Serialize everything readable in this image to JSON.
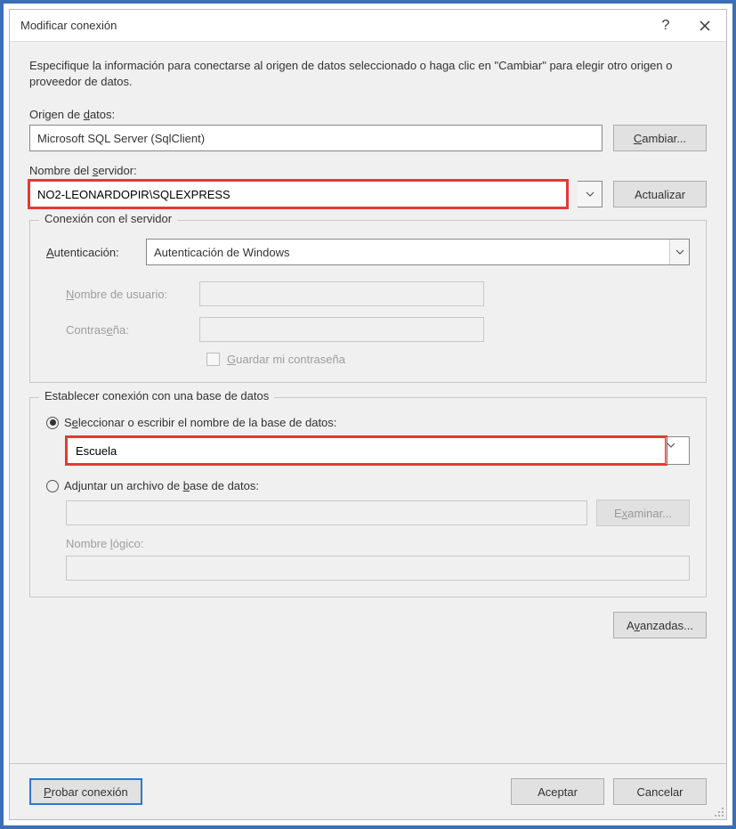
{
  "title": "Modificar conexión",
  "instructions": "Especifique la información para conectarse al origen de datos seleccionado o haga clic en \"Cambiar\" para elegir otro origen o proveedor de datos.",
  "data_source": {
    "label_pre": "Origen de ",
    "label_hot": "d",
    "label_post": "atos:",
    "value": "Microsoft SQL Server (SqlClient)",
    "change_pre": "",
    "change_hot": "C",
    "change_post": "ambiar..."
  },
  "server": {
    "label_pre": "Nombre del ",
    "label_hot": "s",
    "label_post": "ervidor:",
    "value": "NO2-LEONARDOPIR\\SQLEXPRESS",
    "refresh_label": "Actualizar"
  },
  "connection_group": {
    "legend": "Conexión con el servidor",
    "auth_label_hot": "A",
    "auth_label_post": "utenticación:",
    "auth_value": "Autenticación de Windows",
    "user_label_hot": "N",
    "user_label_post": "ombre de usuario:",
    "pass_label_pre": "Contras",
    "pass_label_hot": "e",
    "pass_label_post": "ña:",
    "save_pass_hot": "G",
    "save_pass_post": "uardar mi contraseña"
  },
  "database_group": {
    "legend": "Establecer conexión con una base de datos",
    "radio1_pre": "S",
    "radio1_hot": "e",
    "radio1_post": "leccionar o escribir el nombre de la base de datos:",
    "db_value": "Escuela",
    "radio2_pre": "Adjuntar un archivo de ",
    "radio2_hot": "b",
    "radio2_post": "ase de datos:",
    "browse_pre": "E",
    "browse_hot": "x",
    "browse_post": "aminar...",
    "logical_pre": "Nombre ",
    "logical_hot": "l",
    "logical_post": "ógico:"
  },
  "advanced_pre": "A",
  "advanced_hot": "v",
  "advanced_post": "anzadas...",
  "footer": {
    "test_pre": "",
    "test_hot": "P",
    "test_post": "robar conexión",
    "ok": "Aceptar",
    "cancel": "Cancelar"
  }
}
